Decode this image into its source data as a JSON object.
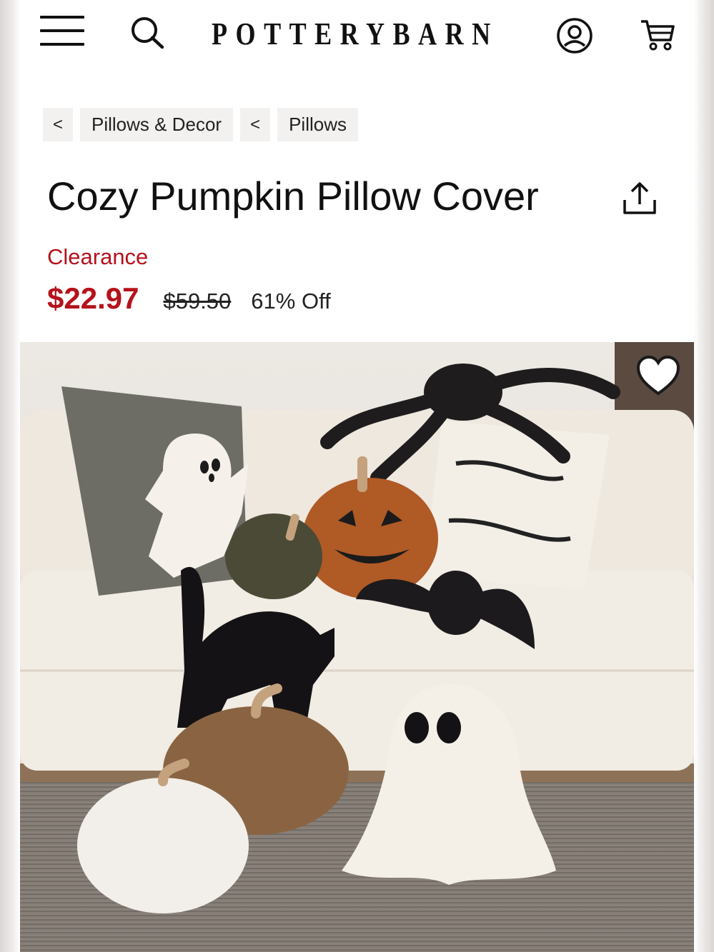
{
  "header": {
    "brand": "POTTERYBARN",
    "icons": [
      "menu-icon",
      "search-icon",
      "account-icon",
      "cart-icon"
    ]
  },
  "breadcrumb": {
    "back_arrow": "<",
    "items": [
      "Pillows & Decor",
      "Pillows"
    ]
  },
  "product": {
    "title": "Cozy Pumpkin Pillow Cover",
    "badge": "Clearance",
    "sale_price": "$22.97",
    "original_price": "$59.50",
    "discount": "61% Off"
  },
  "colors": {
    "accent_red": "#b5121b",
    "crumb_bg": "#f2f1ef"
  }
}
